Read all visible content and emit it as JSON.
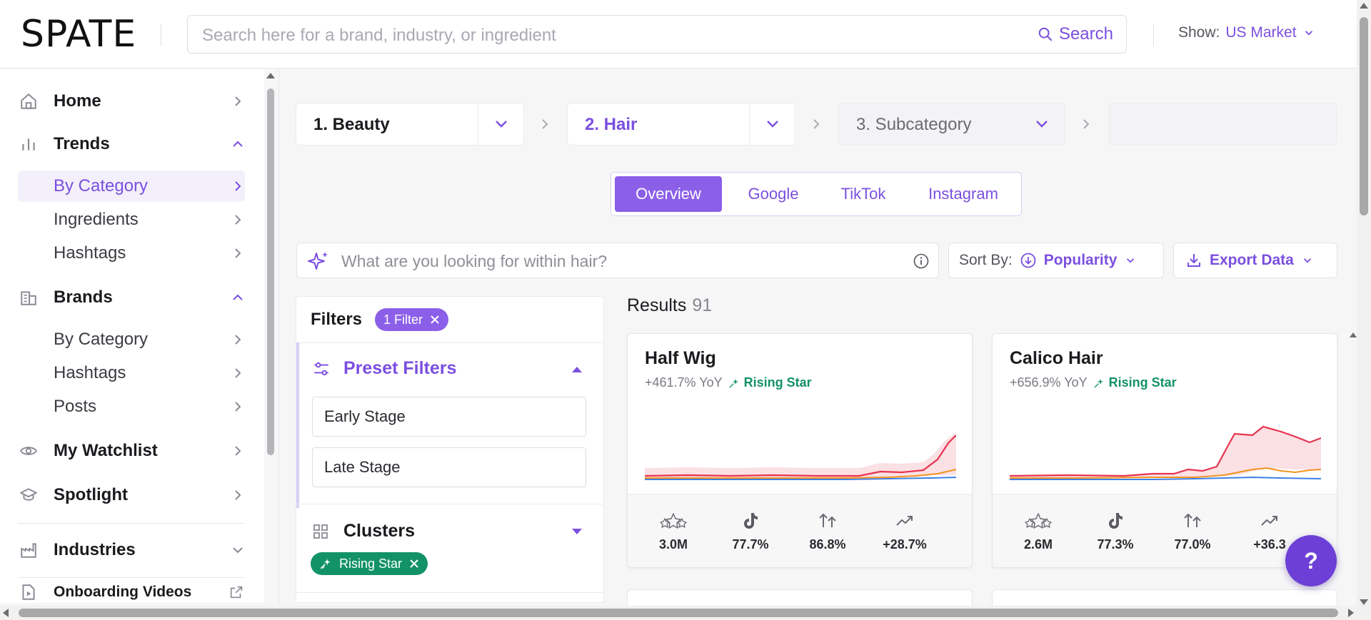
{
  "header": {
    "logo": "SPATE",
    "search_placeholder": "Search here for a brand, industry, or ingredient",
    "search_button": "Search",
    "show_label": "Show:",
    "market": "US Market"
  },
  "sidebar": {
    "home": "Home",
    "trends": "Trends",
    "trends_items": [
      "By Category",
      "Ingredients",
      "Hashtags"
    ],
    "brands": "Brands",
    "brands_items": [
      "By Category",
      "Hashtags",
      "Posts"
    ],
    "watchlist": "My Watchlist",
    "spotlight": "Spotlight",
    "industries": "Industries",
    "onboarding": "Onboarding Videos"
  },
  "breadcrumb": {
    "level1": "1. Beauty",
    "level2": "2. Hair",
    "level3": "3. Subcategory"
  },
  "tabs": [
    "Overview",
    "Google",
    "TikTok",
    "Instagram"
  ],
  "query_placeholder": "What are you looking for within hair?",
  "sort": {
    "label": "Sort By:",
    "value": "Popularity"
  },
  "export_label": "Export Data",
  "filters": {
    "title": "Filters",
    "count_pill": "1 Filter",
    "preset_title": "Preset Filters",
    "preset_options": [
      "Early Stage",
      "Late Stage"
    ],
    "clusters_title": "Clusters",
    "active_cluster": "Rising Star"
  },
  "results": {
    "label": "Results",
    "count": "91"
  },
  "cards": [
    {
      "name": "Half Wig",
      "yoy": "+461.7% YoY",
      "tag": "Rising Star",
      "stats": [
        "3.0M",
        "77.7%",
        "86.8%",
        "+28.7%"
      ]
    },
    {
      "name": "Calico Hair",
      "yoy": "+656.9% YoY",
      "tag": "Rising Star",
      "stats": [
        "2.6M",
        "77.3%",
        "77.0%",
        "+36.3"
      ]
    }
  ],
  "help_label": "?",
  "colors": {
    "accent": "#7b4fe0",
    "accent_fill": "#8c5fe8",
    "success": "#149267",
    "line_red": "#e8334f",
    "line_orange": "#f3931f",
    "line_blue": "#3f7fe6"
  },
  "icons": {
    "stats": [
      "stars-icon",
      "tiktok-icon",
      "growth-arrows-icon",
      "trend-up-icon"
    ]
  }
}
